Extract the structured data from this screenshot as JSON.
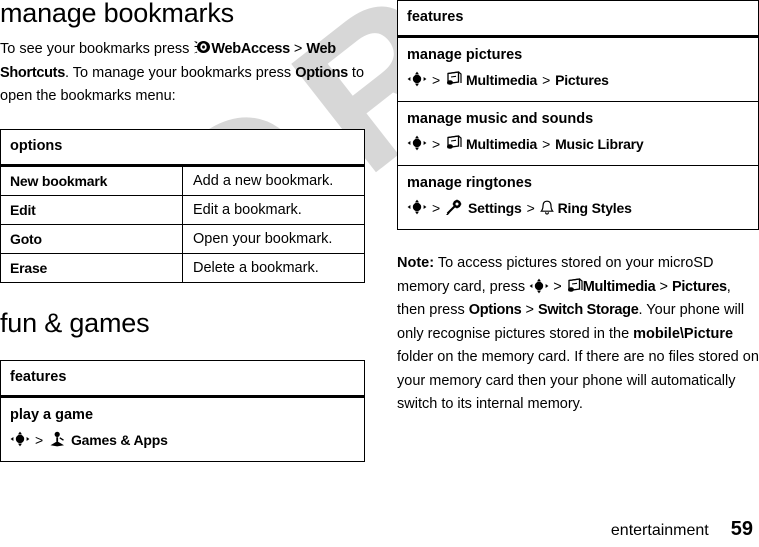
{
  "document": {
    "footer": {
      "section": "entertainment",
      "page_number": "59"
    },
    "watermark": "DRAFT"
  },
  "left_column": {
    "heading": "manage bookmarks",
    "intro": {
      "part1": "To see your bookmarks press ",
      "icon1": "webaccess-icon",
      "bold1": "WebAccess",
      "sep1": ">",
      "bold2": "Web Shortcuts",
      "part2": ". To manage your bookmarks press ",
      "bold3": "Options",
      "part3": " to open the bookmarks menu:"
    },
    "options_table": {
      "header": "options",
      "rows": [
        {
          "key": "New bookmark",
          "value": "Add a new bookmark."
        },
        {
          "key": "Edit",
          "value": "Edit a bookmark."
        },
        {
          "key": "Goto",
          "value": "Open your bookmark."
        },
        {
          "key": "Erase",
          "value": "Delete a bookmark."
        }
      ]
    },
    "heading2": "fun & games",
    "features_table": {
      "header": "features",
      "rows": [
        {
          "title": "play a game",
          "path": {
            "nav_icon": "navigation-key-icon",
            "sep1": ">",
            "icon": "games-apps-icon",
            "label": "Games & Apps"
          }
        }
      ]
    }
  },
  "right_column": {
    "features_table": {
      "header": "features",
      "rows": [
        {
          "title": "manage pictures",
          "path": {
            "nav_icon": "navigation-key-icon",
            "sep1": ">",
            "icon": "multimedia-icon",
            "label1": "Multimedia",
            "sep2": ">",
            "label2": "Pictures"
          }
        },
        {
          "title": "manage music and sounds",
          "path": {
            "nav_icon": "navigation-key-icon",
            "sep1": ">",
            "icon": "multimedia-icon",
            "label1": "Multimedia",
            "sep2": ">",
            "label2": "Music Library"
          }
        },
        {
          "title": "manage ringtones",
          "path": {
            "nav_icon": "navigation-key-icon",
            "sep1": ">",
            "icon": "settings-icon",
            "label1": "Settings",
            "sep2": ">",
            "icon2": "ring-styles-bell-icon",
            "label2": "Ring Styles"
          }
        }
      ]
    },
    "note": {
      "label": "Note:",
      "t1": " To access pictures stored on your microSD memory card, press ",
      "nav_icon": "navigation-key-icon",
      "sep1": ">",
      "mm_icon": "multimedia-icon",
      "b1": "Multimedia",
      "sep2": ">",
      "b2": "Pictures",
      "t2": ", then press ",
      "b3": "Options",
      "sep3": ">",
      "b4": "Switch Storage",
      "t3": ". Your phone will only recognise pictures stored in the ",
      "b5": "mobile\\Picture",
      "t4": " folder on the memory card. If there are no files stored on your memory card then your phone will automatically switch to its internal memory."
    }
  }
}
